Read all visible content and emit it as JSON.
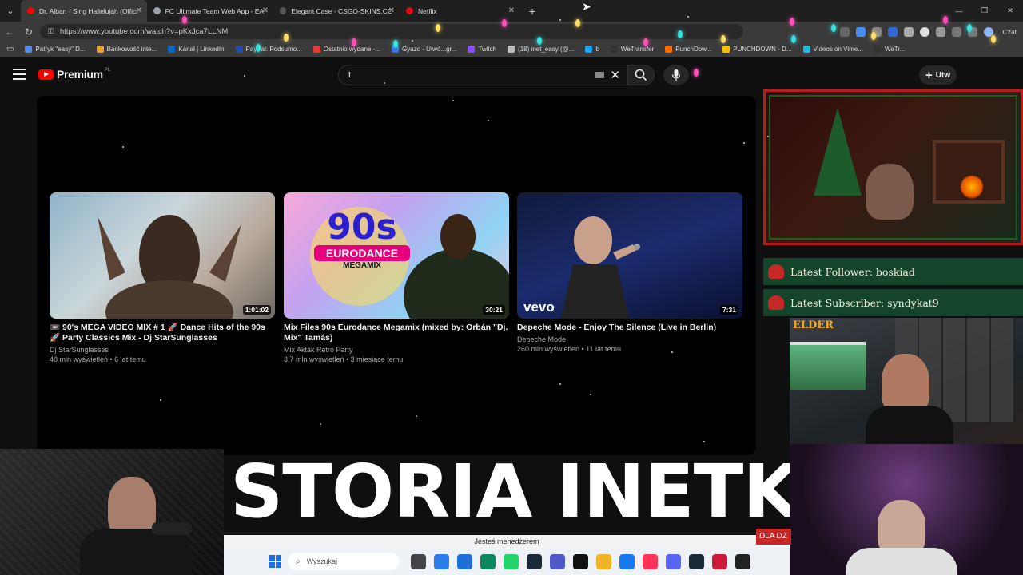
{
  "browser": {
    "tabs": [
      {
        "label": "Dr. Alban - Sing Hallelujah (Offici",
        "fav": "#ff0000",
        "active": true
      },
      {
        "label": "FC Ultimate Team Web App - EA S",
        "fav": "#9aa0a6",
        "active": false
      },
      {
        "label": "Elegant Case - CSGO-SKINS.COM",
        "fav": "#555555",
        "active": false
      },
      {
        "label": "Netflix",
        "fav": "#e50914",
        "active": false
      }
    ],
    "url": "https://www.youtube.com/watch?v=pKxJca7LLNM",
    "chat_label": "Czat",
    "bookmarks": [
      {
        "label": "Patryk \"easy\" D...",
        "color": "#4a8df0"
      },
      {
        "label": "Bankowość inte...",
        "color": "#f0a030"
      },
      {
        "label": "Kanał | LinkedIn",
        "color": "#0a66c2"
      },
      {
        "label": "PayPal: Podsumo...",
        "color": "#1e4fb0"
      },
      {
        "label": "Ostatnio wydane -...",
        "color": "#e53935"
      },
      {
        "label": "Gyazo - Utwó...gr...",
        "color": "#3b6fd8"
      },
      {
        "label": "Twitch",
        "color": "#9146ff"
      },
      {
        "label": "(18) inet_easy (@...",
        "color": "#bbbbbb"
      },
      {
        "label": "b",
        "color": "#1da1f2"
      },
      {
        "label": "WeTransfer",
        "color": "#333333"
      },
      {
        "label": "PunchDow...",
        "color": "#ff6d00"
      },
      {
        "label": "PUNCHDOWN - D...",
        "color": "#fbbc05"
      },
      {
        "label": "Videos on Vime...",
        "color": "#1ab7ea"
      },
      {
        "label": "WeTr...",
        "color": "#333333"
      }
    ]
  },
  "youtube": {
    "brand": "Premium",
    "region": "PL",
    "search_value": "t",
    "create_label": "Utw",
    "videos": [
      {
        "title": "📼 90's MEGA VIDEO MIX # 1 🚀 Dance Hits of the 90s 🚀 Party Classics Mix - Dj StarSunglasses",
        "channel": "Dj StarSunglasses",
        "meta": "48 mln wyświetleń • 6 lat temu",
        "duration": "1:01:02"
      },
      {
        "title": "Mix Files 90s Eurodance Megamix (mixed by: Orbán \"Dj. Mix\" Tamás)",
        "channel": "Mix Akták Retro Party",
        "meta": "3,7 mln wyświetleń • 3 miesiące temu",
        "duration": "30:21"
      },
      {
        "title": "Depeche Mode - Enjoy The Silence (Live in Berlin)",
        "channel": "Depeche Mode",
        "meta": "260 mln wyświetleń • 11 lat temu",
        "duration": "7:31"
      }
    ],
    "thumb2_text": {
      "top": "90s",
      "bottom": "EURODANCE",
      "tag": "MEGAMIX"
    },
    "thumb3_logo": "vevo"
  },
  "stream": {
    "latest_follower": "Latest Follower: boskiad",
    "latest_subscriber": "Latest Subscriber: syndykat9",
    "elder_tag": "ELDER",
    "banner_text": "STORIA INETKO",
    "manager_text": "Jesteś menedżerem",
    "dla_tag": "DLA DZ"
  },
  "taskbar": {
    "search_placeholder": "Wyszukaj",
    "apps": [
      "#444444",
      "#2b7de9",
      "#1f6fd6",
      "#0a8a5c",
      "#25d366",
      "#1b2838",
      "#5059c9",
      "#111111",
      "#f0b429",
      "#1877f2",
      "#ff3355",
      "#5865f2",
      "#1b2838",
      "#cc1a3a",
      "#222222"
    ]
  }
}
